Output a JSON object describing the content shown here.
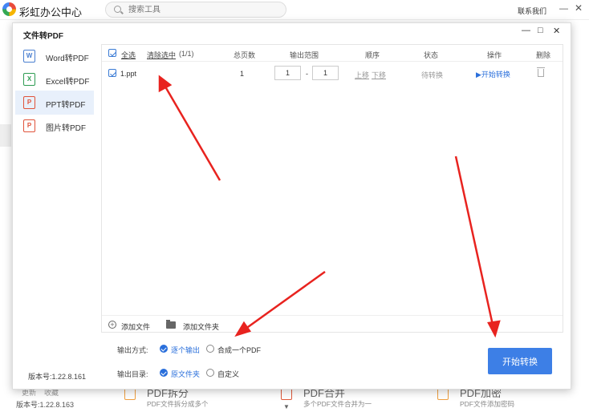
{
  "app": {
    "title": "彩虹办公中心",
    "search_placeholder": "搜索工具",
    "contact": "联系我们",
    "bg_update": "更新",
    "bg_fav": "收藏",
    "bg_version": "版本号:1.22.8.163",
    "bg_cards": [
      {
        "title": "PDF拆分",
        "sub": "PDF文件拆分成多个"
      },
      {
        "title": "PDF合并",
        "sub": "多个PDF文件合并为一"
      },
      {
        "title": "PDF加密",
        "sub": "PDF文件添加密码"
      }
    ]
  },
  "dialog": {
    "title": "文件转PDF",
    "controls": {
      "minimize": "—",
      "maximize": "□",
      "close": "✕"
    },
    "sidebar": {
      "items": [
        {
          "label": "Word转PDF",
          "icon": "word-pdf-icon",
          "color": "#4a7fd0",
          "glyph": "W"
        },
        {
          "label": "Excel转PDF",
          "icon": "excel-pdf-icon",
          "color": "#2e9c52",
          "glyph": "X"
        },
        {
          "label": "PPT转PDF",
          "icon": "ppt-pdf-icon",
          "color": "#e0533b",
          "glyph": "P"
        },
        {
          "label": "图片转PDF",
          "icon": "image-pdf-icon",
          "color": "#e0533b",
          "glyph": "P"
        }
      ],
      "active": 2,
      "version": "版本号:1.22.8.161"
    },
    "table": {
      "headers": {
        "select_all": "全选",
        "clear_selected": "清除选中",
        "count": "(1/1)",
        "pages": "总页数",
        "range": "输出范围",
        "order": "顺序",
        "status": "状态",
        "action": "操作",
        "delete": "删除"
      },
      "rows": [
        {
          "name": "1.ppt",
          "pages": "1",
          "range_from": "1",
          "range_sep": "-",
          "range_to": "1",
          "up": "上移",
          "down": "下移",
          "status": "待转换",
          "action": "▶开始转换"
        }
      ]
    },
    "add_file": "添加文件",
    "add_folder": "添加文件夹",
    "output_mode": {
      "label": "输出方式:",
      "opt1": "逐个输出",
      "opt2": "合成一个PDF"
    },
    "output_dir": {
      "label": "输出目录:",
      "opt1": "原文件夹",
      "opt2": "自定义"
    },
    "start_button": "开始转换"
  },
  "colors": {
    "accent": "#3d7fe6",
    "arrow": "#e8231f"
  }
}
